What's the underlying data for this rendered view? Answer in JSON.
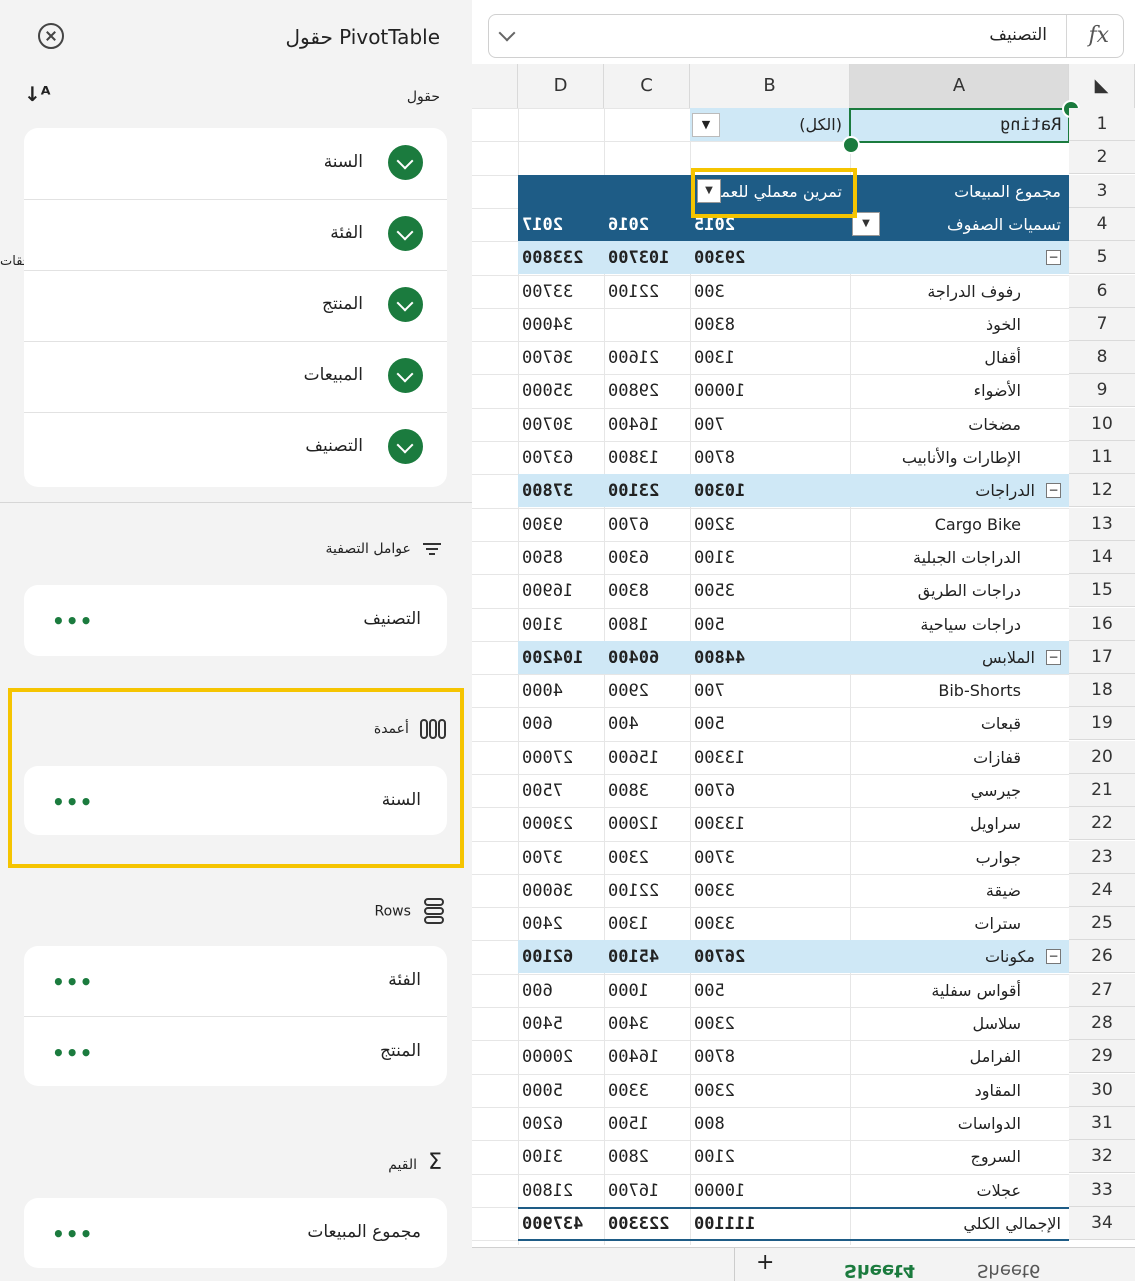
{
  "panel": {
    "title": "حقول PivotTable",
    "fields_label": "حقول",
    "side_tab": "الملحقات",
    "fields": [
      "السنة",
      "الفئة",
      "المنتج",
      "المبيعات",
      "التصنيف"
    ],
    "filters_label": "عوامل التصفية",
    "filters": [
      "التصنيف"
    ],
    "columns_label": "أعمدة",
    "columns": [
      "السنة"
    ],
    "rows_label": "Rows",
    "rows": [
      "الفئة",
      "المنتج"
    ],
    "values_label": "القيم",
    "values": [
      "مجموع المبيعات"
    ],
    "more": "•••"
  },
  "formula": {
    "fx": "fx",
    "text": "التصنيف"
  },
  "columns": [
    "A",
    "B",
    "C",
    "D"
  ],
  "filter_row": {
    "label": "Rating",
    "value": "(الكل)"
  },
  "header_row3": {
    "label": "مجموع المبيعات",
    "col_label": "تمرين معملي للعمودة"
  },
  "header_row4": {
    "label": "تسميات الصفوف",
    "years": [
      "2015",
      "2016",
      "2017"
    ]
  },
  "groups": [
    {
      "row": 5,
      "label": "",
      "v": [
        "29300",
        "103700",
        "233800"
      ]
    },
    {
      "row": 12,
      "label": "الدراجات",
      "v": [
        "10300",
        "23100",
        "37800"
      ]
    },
    {
      "row": 17,
      "label": "الملابس",
      "v": [
        "44800",
        "60400",
        "104200"
      ]
    },
    {
      "row": 26,
      "label": "مكونات",
      "v": [
        "26700",
        "45100",
        "62100"
      ]
    }
  ],
  "items": [
    {
      "row": 6,
      "label": "رفوف الدراجة",
      "v": [
        "300",
        "22100",
        "33700"
      ]
    },
    {
      "row": 7,
      "label": "الخوذ",
      "v": [
        "8300",
        "",
        "34000"
      ]
    },
    {
      "row": 8,
      "label": "أقفال",
      "v": [
        "1300",
        "21600",
        "36700"
      ]
    },
    {
      "row": 9,
      "label": "الأضواء",
      "v": [
        "10000",
        "29800",
        "35000"
      ]
    },
    {
      "row": 10,
      "label": "مضخات",
      "v": [
        "700",
        "16400",
        "30700"
      ]
    },
    {
      "row": 11,
      "label": "الإطارات والأنابيب",
      "v": [
        "8700",
        "13800",
        "63700"
      ]
    },
    {
      "row": 13,
      "label": "Cargo Bike",
      "v": [
        "3200",
        "6700",
        "9300"
      ]
    },
    {
      "row": 14,
      "label": "الدراجات الجبلية",
      "v": [
        "3100",
        "6300",
        "8500"
      ]
    },
    {
      "row": 15,
      "label": "دراجات الطريق",
      "v": [
        "3500",
        "8300",
        "16900"
      ]
    },
    {
      "row": 16,
      "label": "دراجات سياحية",
      "v": [
        "500",
        "1800",
        "3100"
      ]
    },
    {
      "row": 18,
      "label": "Bib-Shorts",
      "v": [
        "700",
        "2900",
        "4000"
      ]
    },
    {
      "row": 19,
      "label": "قبعات",
      "v": [
        "500",
        "400",
        "600"
      ]
    },
    {
      "row": 20,
      "label": "قفازات",
      "v": [
        "13300",
        "15600",
        "27000"
      ]
    },
    {
      "row": 21,
      "label": "جيرسي",
      "v": [
        "6700",
        "3800",
        "7500"
      ]
    },
    {
      "row": 22,
      "label": "سراويل",
      "v": [
        "13300",
        "12000",
        "23000"
      ]
    },
    {
      "row": 23,
      "label": "جوارب",
      "v": [
        "3700",
        "2300",
        "3700"
      ]
    },
    {
      "row": 24,
      "label": "ضيقة",
      "v": [
        "3300",
        "22100",
        "36000"
      ]
    },
    {
      "row": 25,
      "label": "سترات",
      "v": [
        "3300",
        "1300",
        "2400"
      ]
    },
    {
      "row": 27,
      "label": "أقواس سفلية",
      "v": [
        "500",
        "1000",
        "600"
      ]
    },
    {
      "row": 28,
      "label": "سلاسل",
      "v": [
        "2300",
        "3400",
        "5400"
      ]
    },
    {
      "row": 29,
      "label": "الفرامل",
      "v": [
        "8700",
        "16400",
        "20000"
      ]
    },
    {
      "row": 30,
      "label": "المقاود",
      "v": [
        "2300",
        "3300",
        "5000"
      ]
    },
    {
      "row": 31,
      "label": "الدواسات",
      "v": [
        "800",
        "1500",
        "6200"
      ]
    },
    {
      "row": 32,
      "label": "السروج",
      "v": [
        "2100",
        "2800",
        "3100"
      ]
    },
    {
      "row": 33,
      "label": "عجلات",
      "v": [
        "10000",
        "16700",
        "21800"
      ]
    }
  ],
  "total": {
    "row": 34,
    "label": "الإجمالي الكلي",
    "v": [
      "111100",
      "223300",
      "437900"
    ]
  },
  "tabs": {
    "add": "+",
    "sheet4": "Sheet4",
    "sheet6": "Sheet6"
  }
}
